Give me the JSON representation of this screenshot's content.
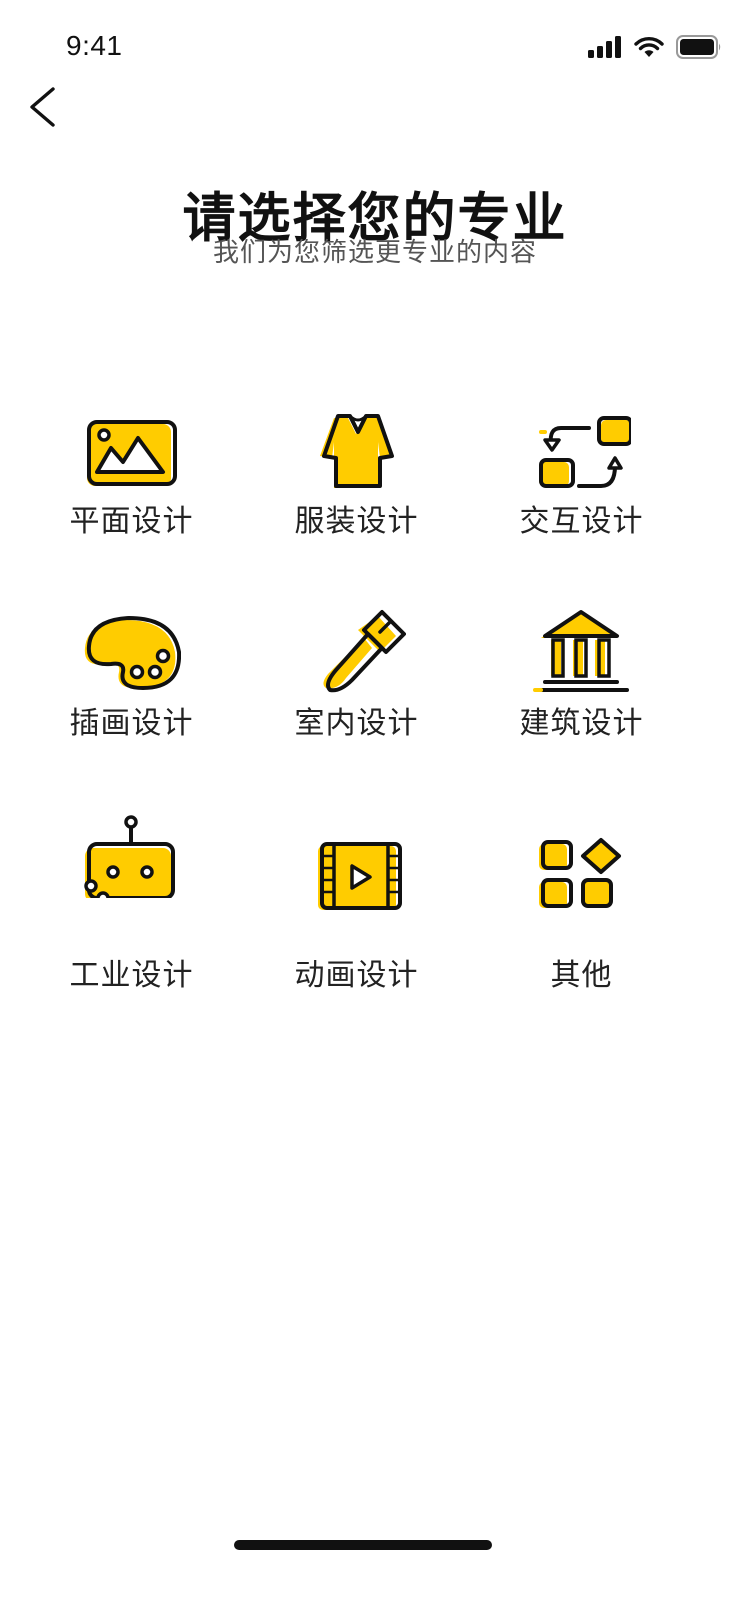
{
  "status_bar": {
    "time": "9:41"
  },
  "header": {
    "title": "请选择您的专业",
    "subtitle": "我们为您筛选更专业的内容"
  },
  "colors": {
    "accent": "#FFCC00",
    "ink": "#111111",
    "subtext": "#555555"
  },
  "majors": [
    {
      "label": "平面设计",
      "icon": "picture-icon"
    },
    {
      "label": "服装设计",
      "icon": "shirt-icon"
    },
    {
      "label": "交互设计",
      "icon": "interaction-icon"
    },
    {
      "label": "插画设计",
      "icon": "palette-icon"
    },
    {
      "label": "室内设计",
      "icon": "paint-brush-icon"
    },
    {
      "label": "建筑设计",
      "icon": "building-icon"
    },
    {
      "label": "工业设计",
      "icon": "robot-icon"
    },
    {
      "label": "动画设计",
      "icon": "video-icon"
    },
    {
      "label": "其他",
      "icon": "apps-icon"
    }
  ]
}
